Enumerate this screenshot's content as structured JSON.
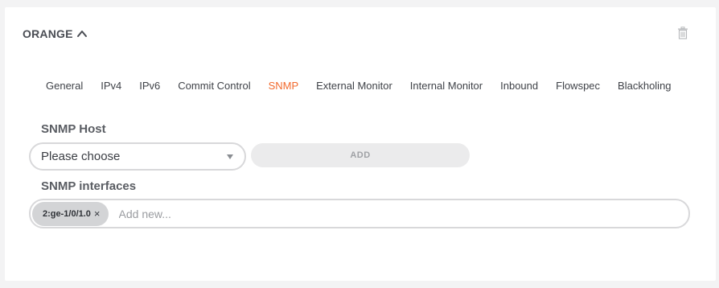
{
  "card": {
    "title": "ORANGE",
    "toggle_icon": "chevron-up-icon",
    "delete_icon": "trash-icon"
  },
  "tabs": [
    {
      "label": "General",
      "active": false
    },
    {
      "label": "IPv4",
      "active": false
    },
    {
      "label": "IPv6",
      "active": false
    },
    {
      "label": "Commit Control",
      "active": false
    },
    {
      "label": "SNMP",
      "active": true
    },
    {
      "label": "External Monitor",
      "active": false
    },
    {
      "label": "Internal Monitor",
      "active": false
    },
    {
      "label": "Inbound",
      "active": false
    },
    {
      "label": "Flowspec",
      "active": false
    },
    {
      "label": "Blackholing",
      "active": false
    }
  ],
  "snmp_host": {
    "label": "SNMP Host",
    "select_value": "Please choose",
    "add_label": "ADD"
  },
  "snmp_interfaces": {
    "label": "SNMP interfaces",
    "chips": [
      {
        "label": "2:ge-1/0/1.0"
      }
    ],
    "remove_glyph": "×",
    "placeholder": "Add new..."
  },
  "colors": {
    "accent": "#f26a2e",
    "text": "#4a4d54",
    "chip_bg": "#d3d4d6"
  }
}
